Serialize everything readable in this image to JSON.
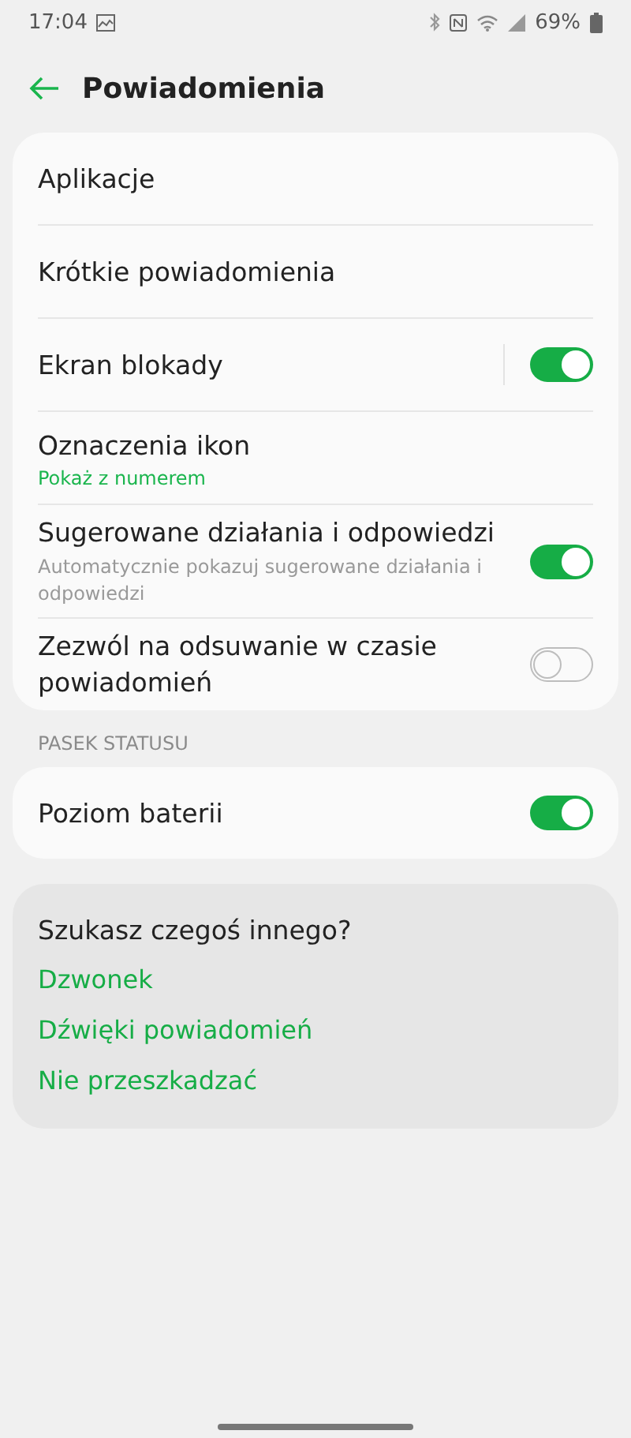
{
  "status_bar": {
    "time": "17:04",
    "battery": "69%"
  },
  "header": {
    "title": "Powiadomienia"
  },
  "main_card": {
    "items": [
      {
        "kind": "link",
        "title": "Aplikacje"
      },
      {
        "kind": "link",
        "title": "Krótkie powiadomienia"
      },
      {
        "kind": "split-toggle",
        "title": "Ekran blokady",
        "on": true
      },
      {
        "kind": "link",
        "title": "Oznaczenia ikon",
        "summary": "Pokaż z numerem"
      },
      {
        "kind": "toggle",
        "title": "Sugerowane działania i odpowiedzi",
        "description": "Automatycznie pokazuj sugerowane działania i odpowiedzi",
        "on": true
      },
      {
        "kind": "toggle",
        "title": "Zezwól na odsuwanie w czasie powiadomień",
        "on": false
      }
    ]
  },
  "status_section": {
    "header": "PASEK STATUSU",
    "items": [
      {
        "kind": "toggle",
        "title": "Poziom baterii",
        "on": true
      }
    ]
  },
  "suggestions": {
    "title": "Szukasz czegoś innego?",
    "links": [
      "Dzwonek",
      "Dźwięki powiadomień",
      "Nie przeszkadzać"
    ]
  }
}
